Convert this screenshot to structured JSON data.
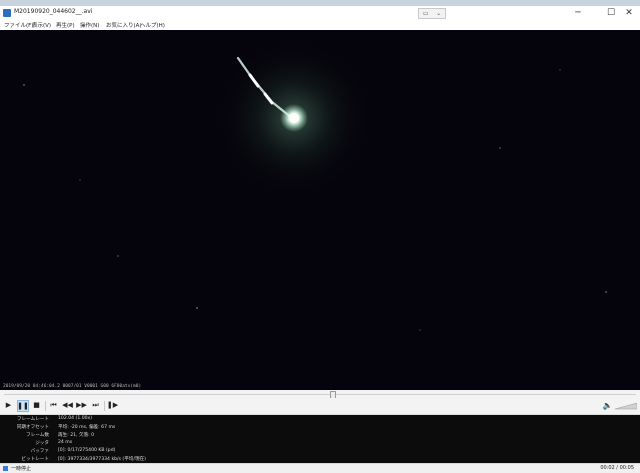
{
  "window": {
    "title": "M20190920_044602__.avi",
    "minimize_glyph": "─",
    "maximize_glyph": "☐",
    "close_glyph": "✕"
  },
  "menu": {
    "items": [
      "ファイル(F)",
      "表示(V)",
      "再生(P)",
      "操作(N)",
      "お気に入り(A)",
      "ヘルプ(H)"
    ]
  },
  "video": {
    "osd_text": "2019/09/20 04:46:04.2  0007/01 V0001 G00  6F00atv(m0)"
  },
  "playback": {
    "play_glyph": "▶",
    "pause_glyph": "❚❚",
    "stop_glyph": "■",
    "prev_glyph": "⏮",
    "rewind_glyph": "◀◀",
    "forward_glyph": "▶▶",
    "next_glyph": "⏭",
    "frame_step_glyph": "❚▶",
    "volume_glyph": "🔈",
    "seek_position": 0.52
  },
  "stats": [
    {
      "label": "フレームレート",
      "value": "102.04 (1.00x)"
    },
    {
      "label": "同期オフセット",
      "value": "平均: -20 ms, 偏差: 67 ms"
    },
    {
      "label": "フレーム数",
      "value": "再生: 21, 欠落: 0"
    },
    {
      "label": "ジッタ",
      "value": "24 ms"
    },
    {
      "label": "バッファ",
      "value": "[0]: 0/17/275400 KB (pd)"
    },
    {
      "label": "ビットレート",
      "value": "[0]: 3977334/3977334 kb/s (平均/現在)"
    }
  ],
  "status": {
    "text": "一時停止",
    "time": "00:02 / 00:05"
  },
  "colors": {
    "video_background": "#05030b",
    "stats_background": "#0c0c0c",
    "active_button": "#cfe3f7"
  }
}
